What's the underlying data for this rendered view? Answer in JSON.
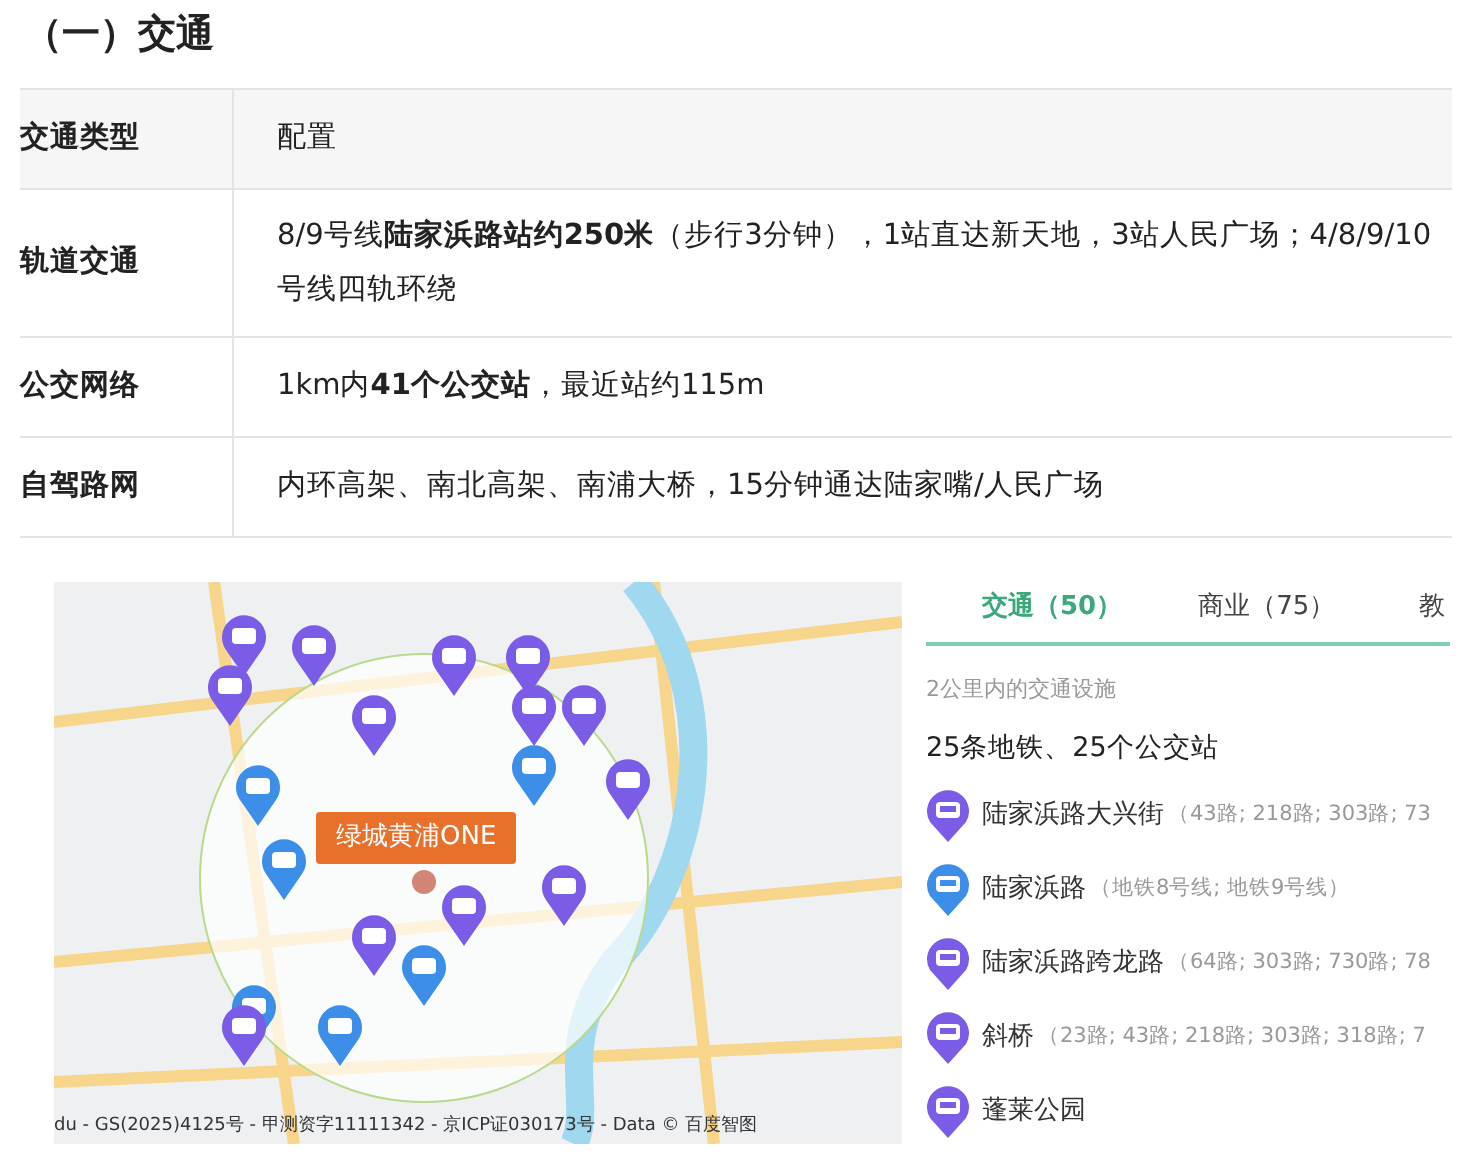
{
  "heading": "（一）交通",
  "table": {
    "columns": [
      "交通类型",
      "配置"
    ],
    "rows": [
      {
        "type": "轨道交通",
        "config": "8/9号线**陆家浜路站约250米**（步行3分钟），1站直达新天地，3站人民广场；4/8/9/10号线四轨环绕"
      },
      {
        "type": "公交网络",
        "config": "1km内**41个公交站**，最近站约115m"
      },
      {
        "type": "自驾路网",
        "config": "内环高架、南北高架、南浦大桥，15分钟通达陆家嘴/人民广场"
      }
    ]
  },
  "map": {
    "callout": "绿城黄浦ONE",
    "attribution": "du - GS(2025)4125号 - 甲测资字11111342 - 京ICP证030173号 - Data © 百度智图"
  },
  "panel": {
    "tabs": [
      {
        "label": "交通（50）",
        "selected": true
      },
      {
        "label": "商业（75）",
        "selected": false
      },
      {
        "label": "教",
        "selected": false
      }
    ],
    "subtitle": "2公里内的交通设施",
    "summary": "25条地铁、25个公交站",
    "items": [
      {
        "kind": "bus",
        "name": "陆家浜路大兴街",
        "detail": "（43路; 218路; 303路; 73"
      },
      {
        "kind": "metro",
        "name": "陆家浜路",
        "detail": "（地铁8号线; 地铁9号线）"
      },
      {
        "kind": "bus",
        "name": "陆家浜路跨龙路",
        "detail": "（64路; 303路; 730路; 78"
      },
      {
        "kind": "bus",
        "name": "斜桥",
        "detail": "（23路; 43路; 218路; 303路; 318路; 7"
      },
      {
        "kind": "bus",
        "name": "蓬莱公园"
      }
    ]
  }
}
